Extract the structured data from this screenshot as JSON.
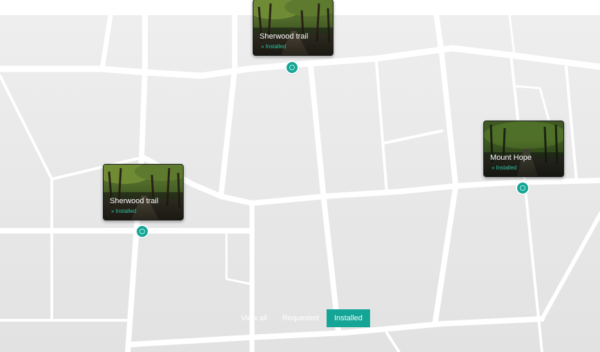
{
  "map": {
    "background": "#eeeeee",
    "road_color": "#ffffff",
    "accent": "#15a596",
    "status_color": "#2fc4a4"
  },
  "markers": [
    {
      "title": "Sherwood trail",
      "status": "Installed",
      "status_icon": "double-chevron-down-icon",
      "photo": "forest-trail-photo"
    },
    {
      "title": "Mount Hope",
      "status": "Installed",
      "status_icon": "double-chevron-down-icon",
      "photo": "forest-trail-photo"
    },
    {
      "title": "Sherwood trail",
      "status": "Installed",
      "status_icon": "double-chevron-down-icon",
      "photo": "forest-trail-photo"
    }
  ],
  "filters": {
    "items": [
      {
        "label": "View all",
        "active": false
      },
      {
        "label": "Requested",
        "active": false
      },
      {
        "label": "Installed",
        "active": true
      }
    ]
  }
}
